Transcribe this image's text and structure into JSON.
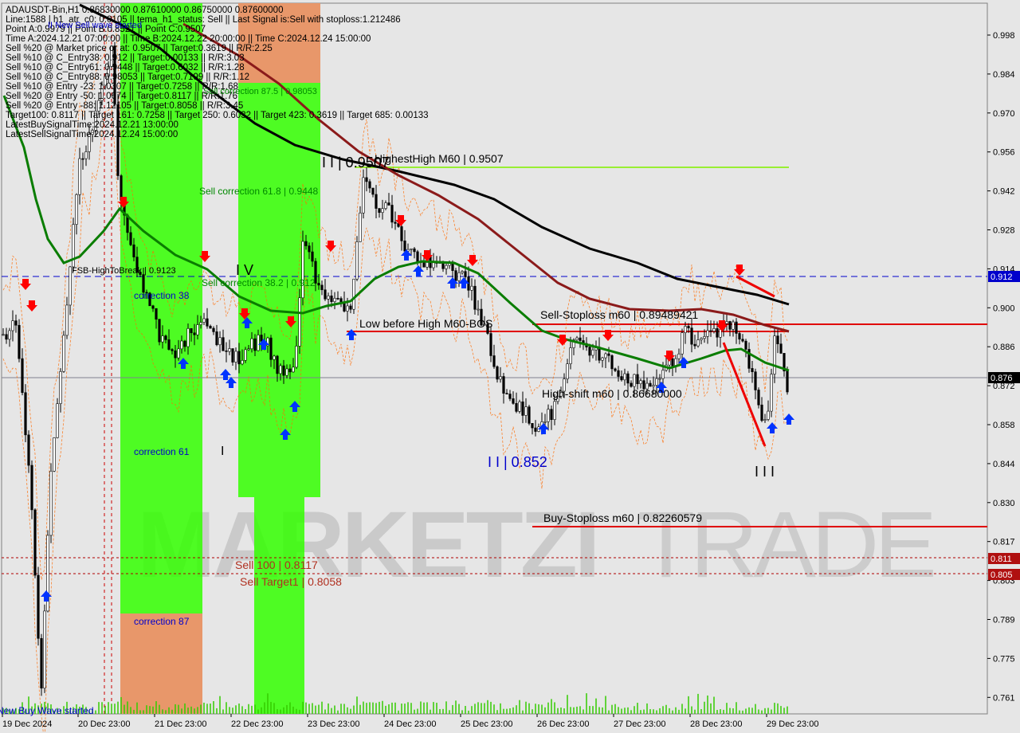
{
  "header": {
    "info_lines": [
      "ADAUSDT-Bin,H1  0.86830000 0.87610000 0.86750000 0.87600000",
      "Line:1588 | h1_atr_c0: 0.0105 || tema_h1_status: Sell || Last Signal is:Sell with stoploss:1.212486",
      "Point A:0.9979 || Point B:0.8521 || Point C:0.9507",
      "Time A:2024.12.21 07:00:00 || Time B:2024.12.22 20:00:00 || Time C:2024.12.24 15:00:00",
      "Sell %20 @ Market price or at: 0.9507 || Target:0.3619 || R/R:2.25",
      "Sell %10 @ C_Entry38: 0.912 || Target:0.00133 || R/R:3.03",
      "Sell %10 @ C_Entry61: 0.9448 || Target:0.6032 || R/R:1.28",
      "Sell %10 @ C_Entry88: 0.98053 || Target:0.7199 || R/R:1.12",
      "Sell %10 @ Entry -23: 1.0307 || Target:0.7258 || R/R:1.68",
      "Sell %20 @ Entry -50: 1.0674 || Target:0.8117 || R/R:1.76",
      "Sell %20 @ Entry -88: 1.12105 || Target:0.8058 || R/R:3.45",
      "Target100: 0.8117 || Target 161: 0.7258 || Target 250: 0.6032 || Target 423: 0.3619 || Target 685: 0.00133",
      "LatestBuySignalTime:2024.12.21 13:00:00",
      "LatestSellSignalTime:2024.12.24 15:00:00"
    ]
  },
  "price_axis": {
    "labels": [
      "0.998",
      "0.984",
      "0.970",
      "0.956",
      "0.942",
      "0.928",
      "0.914",
      "0.900",
      "0.886",
      "0.872",
      "0.858",
      "0.844",
      "0.830",
      "0.817",
      "0.803",
      "0.789",
      "0.775",
      "0.761"
    ],
    "tags": {
      "fsb_high": "0.912",
      "current": "0.876",
      "sell_100": "0.811",
      "sell_target1": "0.805"
    }
  },
  "time_axis": {
    "labels": [
      "19 Dec 2024",
      "20 Dec 23:00",
      "21 Dec 23:00",
      "22 Dec 23:00",
      "23 Dec 23:00",
      "24 Dec 23:00",
      "25 Dec 23:00",
      "26 Dec 23:00",
      "27 Dec 23:00",
      "28 Dec 23:00",
      "29 Dec 23:00"
    ]
  },
  "annotations": {
    "new_sell_wave": "II New Sell wave started",
    "correction_38_top": "Sell correction 87.5 | 0.98053",
    "highest_high": "I I | 0.9507",
    "highest_high_label": "HighestHigh   M60 | 0.9507",
    "sell_correction_61": "Sell correction 61.8 | 0.9448",
    "fsb_high": "FSB-HighToBreak | 0.9123",
    "roman_iv": "I V",
    "sell_correction_38": "Sell correction 38.2 | 0.912",
    "correction_38": "correction 38",
    "low_before_high": "Low before High   M60-BOS",
    "sell_stoploss": "Sell-Stoploss m60 | 0.89489421",
    "high_shift": "High-shift m60 | 0.86680000",
    "point_b": "I I | 0.852",
    "roman_i": "I",
    "roman_iii": "I I I",
    "correction_61": "correction 61",
    "buy_stoploss": "Buy-Stoploss m60 | 0.82260579",
    "sell_100": "Sell 100 | 0.8117",
    "sell_target1": "Sell Target1 | 0.8058",
    "correction_87": "correction 87",
    "new_buy_wave": "New Buy Wave started"
  },
  "watermark": {
    "part1": "MARKETZI",
    "part2": "TRADE"
  },
  "colors": {
    "background": "#e6e6e6",
    "bull_candle": "#000000",
    "bear_candle": "#000000",
    "ma_fast": "#0a7d00",
    "ma_mid": "#8b1a1a",
    "ma_slow": "#000000",
    "zone_green": "#33ff00",
    "zone_orange": "#e8976a",
    "level_red": "#e00000",
    "level_blue": "#0000cc",
    "signal_up": "#0033ff",
    "signal_down": "#ff0000"
  }
}
